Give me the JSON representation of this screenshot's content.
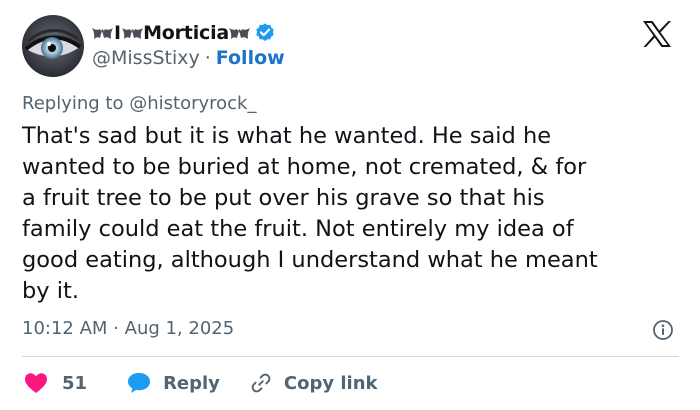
{
  "author": {
    "display_name": "Morticia",
    "handle": "@MissStixy",
    "follow_label": "Follow",
    "verified": true
  },
  "reply_context": {
    "prefix": "Replying to",
    "mention": "@historyrock_"
  },
  "tweet": {
    "lines": [
      "That's sad but it is what he wanted. He said he",
      "wanted to be buried at home, not cremated, & for",
      "a fruit tree to be put over his grave so that his",
      "family could eat the fruit. Not entirely my idea of",
      "good eating, although I understand what he meant",
      "by it."
    ],
    "time": "10:12 AM",
    "date": "Aug 1, 2025"
  },
  "actions": {
    "like_count": "51",
    "reply_label": "Reply",
    "copy_link_label": "Copy link"
  },
  "colors": {
    "text": "#0f1419",
    "secondary": "#536471",
    "follow": "#1d73c9",
    "verified": "#1d9bf0",
    "like": "#f91880",
    "reply_icon": "#1d9bf0",
    "divider": "#cfd9de"
  },
  "icons": [
    "avatar-eye",
    "bat-icon",
    "verified-badge-icon",
    "x-logo-icon",
    "info-icon",
    "heart-icon",
    "reply-bubble-icon",
    "link-icon"
  ]
}
